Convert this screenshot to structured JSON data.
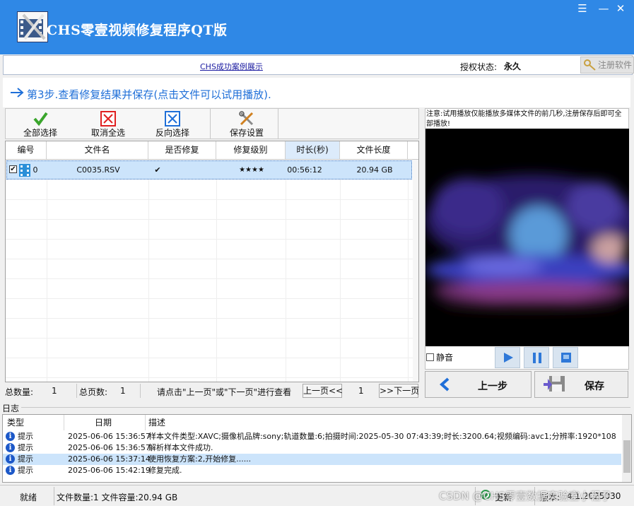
{
  "app": {
    "title": "CHS零壹视频修复程序QT版"
  },
  "info": {
    "case_link": "CHS成功案例展示",
    "auth_label": "授权状态:",
    "auth_value": "永久",
    "register_button": "注册软件"
  },
  "step": {
    "text": "第3步.查看修复结果并保存(点击文件可以试用播放)."
  },
  "toolbar": {
    "select_all": "全部选择",
    "deselect_all": "取消全选",
    "invert": "反向选择",
    "save_settings": "保存设置"
  },
  "table": {
    "columns": [
      "编号",
      "文件名",
      "是否修复",
      "修复级别",
      "时长(秒)",
      "文件长度"
    ],
    "rows": [
      {
        "id": "0",
        "name": "C0035.RSV",
        "repaired": "✔",
        "level": "★★★★",
        "duration": "00:56:12",
        "size": "20.94 GB"
      }
    ]
  },
  "paging": {
    "total_label": "总数量:",
    "total": "1",
    "pages_label": "总页数:",
    "pages": "1",
    "hint": "请点击\"上一页\"或\"下一页\"进行查看",
    "prev": "上一页<<",
    "current": "1",
    "next": ">>下一页"
  },
  "preview": {
    "note": "注意:试用播放仅能播放多媒体文件的前几秒,注册保存后即可全部播放!",
    "mute_label": "静音"
  },
  "actions": {
    "prev_step": "上一步",
    "save": "保存"
  },
  "log": {
    "title": "日志",
    "columns": [
      "类型",
      "日期",
      "描述"
    ],
    "rows": [
      {
        "type": "提示",
        "date": "2025-06-06 15:36:57",
        "desc": "样本文件类型:XAVC;摄像机品牌:sony;轨道数量:6;拍摄时间:2025-05-30 07:43:39;时长:3200.64;视频编码:avc1;分辨率:1920*1080..."
      },
      {
        "type": "提示",
        "date": "2025-06-06 15:36:57",
        "desc": "解析样本文件成功."
      },
      {
        "type": "提示",
        "date": "2025-06-06 15:37:14",
        "desc": "使用恢复方案:2,开始修复......"
      },
      {
        "type": "提示",
        "date": "2025-06-06 15:42:19",
        "desc": "修复完成."
      }
    ]
  },
  "status": {
    "ready": "就绪",
    "summary": "文件数量:1 文件容量:20.94 GB",
    "update": "更新",
    "version_label": "版本:",
    "version": "4.1.2025030"
  },
  "watermark": "CSDN @CHS零壹数据实验室小程子",
  "colors": {
    "titlebar": "#2f88e6",
    "accent_text": "#1f6fd8",
    "selection": "#cce4fb"
  }
}
